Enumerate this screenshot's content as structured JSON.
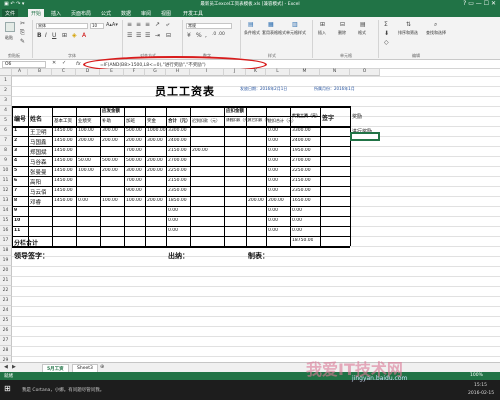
{
  "window": {
    "title": "最新员工excel工资表模板.xls [兼容模式] - Excel",
    "qat": "▣ ↶ ↷ ▾",
    "controls": "?  ▭  —  ☐  ✕"
  },
  "menu": {
    "tabs": [
      "文件",
      "开始",
      "插入",
      "页面布局",
      "公式",
      "数据",
      "审阅",
      "视图",
      "开发工具"
    ],
    "active_index": 1
  },
  "ribbon": {
    "paste": "粘贴",
    "font_name": "宋体",
    "font_size": "10",
    "font_group": "字体",
    "align_group": "对齐方式",
    "number_format": "常规",
    "number_group": "数字",
    "style_group": "样式",
    "style_buttons": [
      "条件格式",
      "套用表格格式",
      "单元格样式"
    ],
    "cell_buttons": [
      "插入",
      "删除",
      "格式"
    ],
    "edit_buttons": [
      "排序和筛选",
      "查找和选择"
    ],
    "cells_group": "单元格",
    "edit_group": "编辑",
    "clip_group": "剪贴板"
  },
  "formula_bar": {
    "name_box": "O6",
    "fx": "fx",
    "formula": "=IF(AND(B8>1500,L8<=0),\"进行奖励\",\"不奖励\")"
  },
  "columns": [
    "A",
    "B",
    "C",
    "D",
    "E",
    "F",
    "G",
    "H",
    "I",
    "J",
    "K",
    "L",
    "M",
    "N",
    "O"
  ],
  "rows": [
    "1",
    "2",
    "3",
    "4",
    "5",
    "6",
    "7",
    "8",
    "9",
    "10",
    "11",
    "12",
    "13",
    "14",
    "15",
    "16",
    "17",
    "18",
    "19",
    "20",
    "21",
    "22",
    "23",
    "24",
    "25",
    "26",
    "27",
    "28",
    "29"
  ],
  "sheet": {
    "title": "员工工资表",
    "date_label": "发放日期：2016年2月1日",
    "period_label": "所属月份：2016年1月",
    "headers": {
      "num": "编号",
      "name": "姓名",
      "should_pay": "应发金额",
      "deduct": "应扣金额",
      "base": "基本工资",
      "perf": "业绩奖",
      "subsidy": "补助",
      "overtime": "加班",
      "bonus": "奖金",
      "total": "合计（元）",
      "late": "迟到扣款（元）",
      "leave": "请假扣款（元）",
      "other": "其它扣款（元）",
      "ded_total": "应扣合计（元）",
      "actual": "实发工资（元）",
      "sign": "签字",
      "reward": "奖励"
    },
    "records": [
      {
        "no": "1",
        "name": "王卫明",
        "base": "1450.00",
        "perf": "100.00",
        "subsidy": "300.00",
        "ot": "500.00",
        "bonus": "1000.00",
        "total": "3300.00",
        "late": "",
        "leave": "",
        "other": "",
        "dtotal": "0.00",
        "actual": "3300.00",
        "reward": "进行奖励"
      },
      {
        "no": "2",
        "name": "马国鑫",
        "base": "1450.00",
        "perf": "200.00",
        "subsidy": "200.00",
        "ot": "200.00",
        "bonus": "300.00",
        "total": "2400.00",
        "late": "",
        "leave": "",
        "other": "",
        "dtotal": "0.00",
        "actual": "2400.00",
        "reward": ""
      },
      {
        "no": "3",
        "name": "郑国斌",
        "base": "1450.00",
        "perf": "",
        "subsidy": "",
        "ot": "700.00",
        "bonus": "",
        "total": "2150.00",
        "late": "200.00",
        "leave": "",
        "other": "",
        "dtotal": "0.00",
        "actual": "1950.00",
        "reward": ""
      },
      {
        "no": "4",
        "name": "马谷森",
        "base": "1450.00",
        "perf": "50.00",
        "subsidy": "500.00",
        "ot": "500.00",
        "bonus": "200.00",
        "total": "2700.00",
        "late": "",
        "leave": "",
        "other": "",
        "dtotal": "0.00",
        "actual": "2700.00",
        "reward": ""
      },
      {
        "no": "5",
        "name": "张曼曼",
        "base": "1450.00",
        "perf": "100.00",
        "subsidy": "200.00",
        "ot": "300.00",
        "bonus": "200.00",
        "total": "2250.00",
        "late": "",
        "leave": "",
        "other": "",
        "dtotal": "0.00",
        "actual": "2250.00",
        "reward": ""
      },
      {
        "no": "6",
        "name": "高阳",
        "base": "1450.00",
        "perf": "",
        "subsidy": "",
        "ot": "700.00",
        "bonus": "",
        "total": "2150.00",
        "late": "",
        "leave": "",
        "other": "",
        "dtotal": "0.00",
        "actual": "2150.00",
        "reward": ""
      },
      {
        "no": "7",
        "name": "马云佰",
        "base": "1450.00",
        "perf": "",
        "subsidy": "",
        "ot": "900.00",
        "bonus": "",
        "total": "2350.00",
        "late": "",
        "leave": "",
        "other": "",
        "dtotal": "0.00",
        "actual": "2350.00",
        "reward": ""
      },
      {
        "no": "8",
        "name": "邓睿",
        "base": "1450.00",
        "perf": "0.00",
        "subsidy": "100.00",
        "ot": "100.00",
        "bonus": "200.00",
        "total": "1850.00",
        "late": "",
        "leave": "",
        "other": "200.00",
        "dtotal": "200.00",
        "actual": "1650.00",
        "reward": ""
      },
      {
        "no": "9",
        "name": "",
        "base": "",
        "perf": "",
        "subsidy": "",
        "ot": "",
        "bonus": "",
        "total": "0.00",
        "late": "",
        "leave": "",
        "other": "",
        "dtotal": "0.00",
        "actual": "0.00",
        "reward": ""
      },
      {
        "no": "10",
        "name": "",
        "base": "",
        "perf": "",
        "subsidy": "",
        "ot": "",
        "bonus": "",
        "total": "0.00",
        "late": "",
        "leave": "",
        "other": "",
        "dtotal": "0.00",
        "actual": "0.00",
        "reward": ""
      },
      {
        "no": "11",
        "name": "",
        "base": "",
        "perf": "",
        "subsidy": "",
        "ot": "",
        "bonus": "",
        "total": "0.00",
        "late": "",
        "leave": "",
        "other": "",
        "dtotal": "0.00",
        "actual": "0.00",
        "reward": ""
      }
    ],
    "total_label": "分栏合计",
    "total_actual": "18750.00",
    "leader_sign": "领导签字：",
    "cashier": "出纳：",
    "maker": "制表："
  },
  "sheet_tabs": [
    "5月工资",
    "Sheet3"
  ],
  "status": {
    "ready": "就绪",
    "zoom": "100%"
  },
  "taskbar": {
    "search": "我是 Cortana，小娜。有问题尽管问我。",
    "time": "15:15",
    "date": "2016-02-15"
  },
  "watermark": {
    "main": "我爱IT技术网",
    "sub": "jingyan.baidu.com"
  },
  "colors": {
    "excel_green": "#217346",
    "annotation_red": "#d81c1c"
  }
}
